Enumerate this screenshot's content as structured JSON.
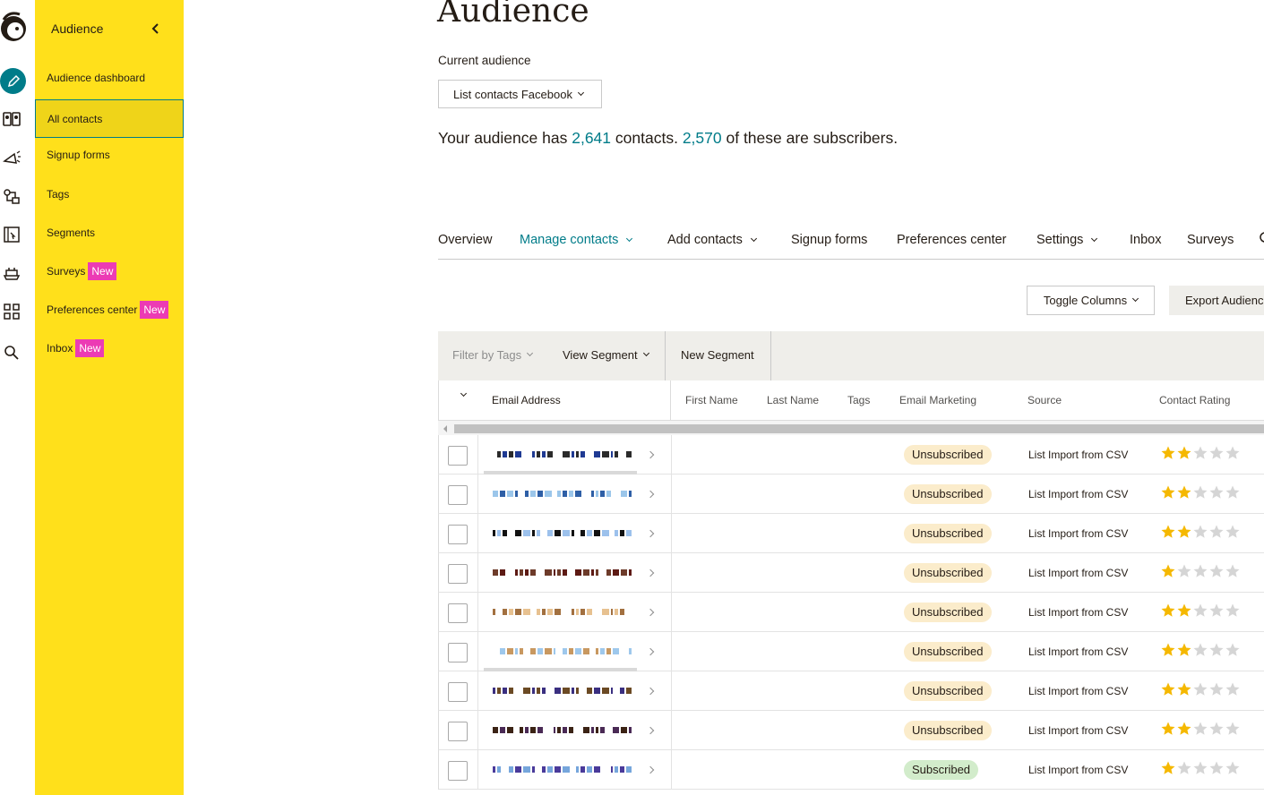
{
  "rail": {
    "icons": [
      "freddie-logo-icon",
      "pencil-icon",
      "audience-icon",
      "campaign-megaphone-icon",
      "automation-icon",
      "website-icon",
      "integrations-icon",
      "grid-icon",
      "search-icon"
    ]
  },
  "sidebar": {
    "header": "Audience",
    "items": [
      {
        "label": "Audience dashboard",
        "badge": ""
      },
      {
        "label": "All contacts",
        "badge": ""
      },
      {
        "label": "Signup forms",
        "badge": ""
      },
      {
        "label": "Tags",
        "badge": ""
      },
      {
        "label": "Segments",
        "badge": ""
      },
      {
        "label": "Surveys",
        "badge": "New"
      },
      {
        "label": "Preferences center",
        "badge": "New"
      },
      {
        "label": "Inbox",
        "badge": "New"
      }
    ]
  },
  "main": {
    "title": "Audience",
    "current_audience_label": "Current audience",
    "current_audience_value": "List contacts Facebook",
    "summary": {
      "prefix": "Your audience has",
      "contacts": "2,641",
      "middle": "contacts.",
      "subscribers": "2,570",
      "suffix": "of these are subscribers."
    },
    "tabs": [
      {
        "label": "Overview",
        "dropdown": false
      },
      {
        "label": "Manage contacts",
        "dropdown": true
      },
      {
        "label": "Add contacts",
        "dropdown": true
      },
      {
        "label": "Signup forms",
        "dropdown": false
      },
      {
        "label": "Preferences center",
        "dropdown": false
      },
      {
        "label": "Settings",
        "dropdown": true
      },
      {
        "label": "Inbox",
        "dropdown": false
      },
      {
        "label": "Surveys",
        "dropdown": false
      }
    ],
    "toggle_columns": "Toggle Columns",
    "export_audience": "Export Audience",
    "filter_by_tags": "Filter by Tags",
    "view_segment": "View Segment",
    "new_segment": "New Segment",
    "columns": [
      "Email Address",
      "First Name",
      "Last Name",
      "Tags",
      "Email Marketing",
      "Source",
      "Contact Rating"
    ],
    "rows": [
      {
        "status": "Unsubscribed",
        "source": "List Import from CSV",
        "rating": 2
      },
      {
        "status": "Unsubscribed",
        "source": "List Import from CSV",
        "rating": 2
      },
      {
        "status": "Unsubscribed",
        "source": "List Import from CSV",
        "rating": 2
      },
      {
        "status": "Unsubscribed",
        "source": "List Import from CSV",
        "rating": 1
      },
      {
        "status": "Unsubscribed",
        "source": "List Import from CSV",
        "rating": 2
      },
      {
        "status": "Unsubscribed",
        "source": "List Import from CSV",
        "rating": 2
      },
      {
        "status": "Unsubscribed",
        "source": "List Import from CSV",
        "rating": 2
      },
      {
        "status": "Unsubscribed",
        "source": "List Import from CSV",
        "rating": 2
      },
      {
        "status": "Subscribed",
        "source": "List Import from CSV",
        "rating": 1
      }
    ]
  },
  "colors": {
    "brand_yellow": "#ffe01b",
    "accent_teal": "#007c89",
    "badge_pink": "#ec3bb4",
    "star_gold": "#f5b800",
    "unsubscribed_bg": "#fbeccb",
    "subscribed_bg": "#d2eccb"
  }
}
